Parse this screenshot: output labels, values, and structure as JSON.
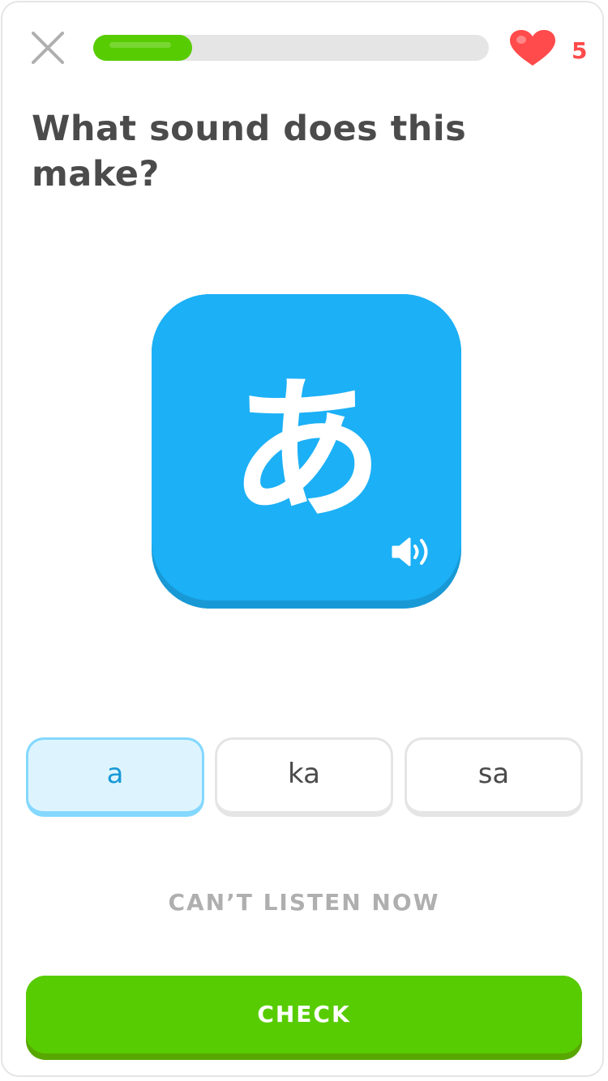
{
  "header": {
    "close_icon": "close-icon",
    "progress": {
      "fraction": 0.25,
      "color": "#58cc02",
      "track_color": "#e5e5e5"
    },
    "hearts": {
      "icon": "heart-icon",
      "count": "5",
      "color": "#ff4b4b"
    }
  },
  "prompt": {
    "text": "What sound does this make?"
  },
  "character_card": {
    "glyph": "あ",
    "speaker_icon": "speaker-icon",
    "color": "#1cb0f6"
  },
  "choices": [
    {
      "label": "a",
      "selected": true
    },
    {
      "label": "ka",
      "selected": false
    },
    {
      "label": "sa",
      "selected": false
    }
  ],
  "cant_listen": {
    "label": "CAN’T LISTEN NOW"
  },
  "check": {
    "label": "CHECK",
    "color": "#58cc02"
  }
}
